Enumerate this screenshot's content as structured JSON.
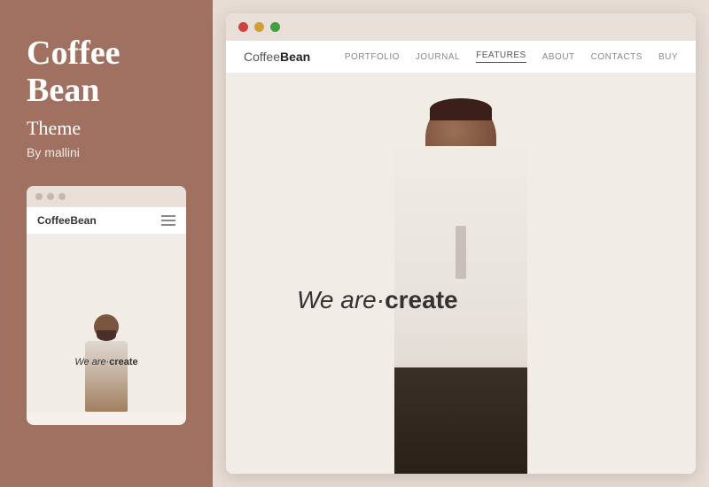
{
  "sidebar": {
    "title_line1": "Coffee",
    "title_line2": "Bean",
    "subtitle": "Theme",
    "author": "By mallini",
    "colors": {
      "bg": "#a07060"
    }
  },
  "small_mockup": {
    "logo_light": "Coffee",
    "logo_bold": "Bean",
    "tagline_italic": "We are·",
    "tagline_bold": "create"
  },
  "browser": {
    "dots": [
      "red",
      "yellow",
      "green"
    ],
    "logo_light": "Coffee",
    "logo_bold": "Bean",
    "nav_items": [
      {
        "label": "PORTFOLIO",
        "active": false
      },
      {
        "label": "JOURNAL",
        "active": false
      },
      {
        "label": "FEATURES",
        "active": true
      },
      {
        "label": "ABOUT",
        "active": false
      },
      {
        "label": "CONTACTS",
        "active": false
      },
      {
        "label": "BUY",
        "active": false
      }
    ],
    "tagline_italic": "We are·",
    "tagline_bold": "create"
  }
}
